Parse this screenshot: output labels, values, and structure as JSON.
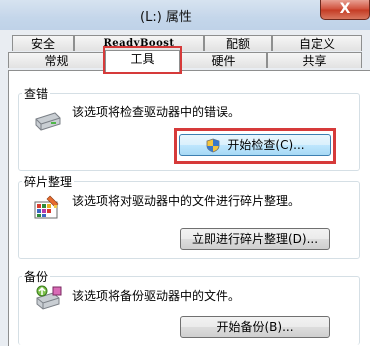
{
  "window": {
    "title": "(L:) 属性",
    "close_glyph": "X"
  },
  "tabs": {
    "upper": [
      "安全",
      "ReadyBoost",
      "配额",
      "自定义"
    ],
    "lower": [
      "常规",
      "工具",
      "硬件",
      "共享"
    ],
    "active": "工具"
  },
  "sections": {
    "check": {
      "title": "查错",
      "description": "该选项将检查驱动器中的错误。",
      "button": "开始检查(C)..."
    },
    "defrag": {
      "title": "碎片整理",
      "description": "该选项将对驱动器中的文件进行碎片整理。",
      "button": "立即进行碎片整理(D)..."
    },
    "backup": {
      "title": "备份",
      "description": "该选项将备份驱动器中的文件。",
      "button": "开始备份(B)..."
    }
  },
  "colors": {
    "highlight": "#d63a3a",
    "accent": "#3c7fb1"
  }
}
